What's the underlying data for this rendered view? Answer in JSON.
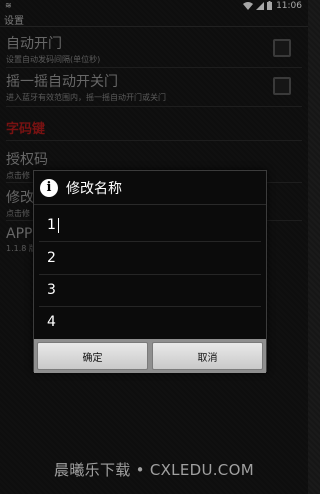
{
  "statusbar": {
    "time": "11:06"
  },
  "header": {
    "title": "设置"
  },
  "preferences": [
    {
      "title": "自动开门",
      "summary": "设置自动发码间隔(单位秒)"
    },
    {
      "title": "摇一摇自动开关门",
      "summary": "进入蓝牙有效范围内，摇一摇自动开门或关门"
    },
    {
      "title": "授权码",
      "summary": "点击修"
    },
    {
      "title": "修改",
      "summary": "点击修"
    },
    {
      "title": "APP",
      "summary": "1.1.8 版"
    }
  ],
  "category": {
    "title": "字码键"
  },
  "dialog": {
    "title": "修改名称",
    "items": [
      "1",
      "2",
      "3",
      "4"
    ],
    "confirm_label": "确定",
    "cancel_label": "取消"
  },
  "watermark": {
    "text": "晨曦乐下载 • CXLEDU.COM"
  }
}
